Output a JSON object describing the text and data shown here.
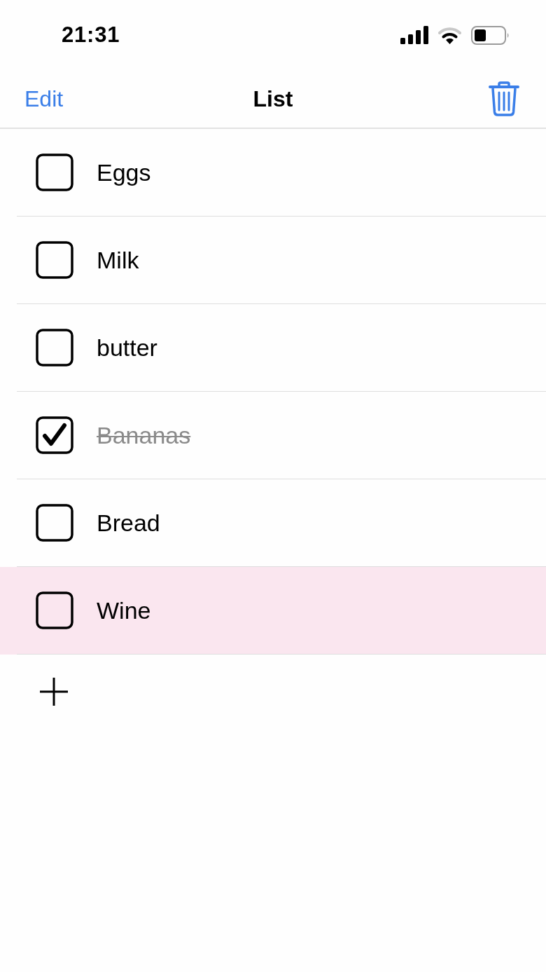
{
  "status_bar": {
    "time": "21:31"
  },
  "nav": {
    "edit": "Edit",
    "title": "List"
  },
  "items": [
    {
      "label": "Eggs",
      "checked": false,
      "selected": false
    },
    {
      "label": "Milk",
      "checked": false,
      "selected": false
    },
    {
      "label": "butter",
      "checked": false,
      "selected": false
    },
    {
      "label": "Bananas",
      "checked": true,
      "selected": false
    },
    {
      "label": "Bread",
      "checked": false,
      "selected": false
    },
    {
      "label": "Wine",
      "checked": false,
      "selected": true
    }
  ]
}
